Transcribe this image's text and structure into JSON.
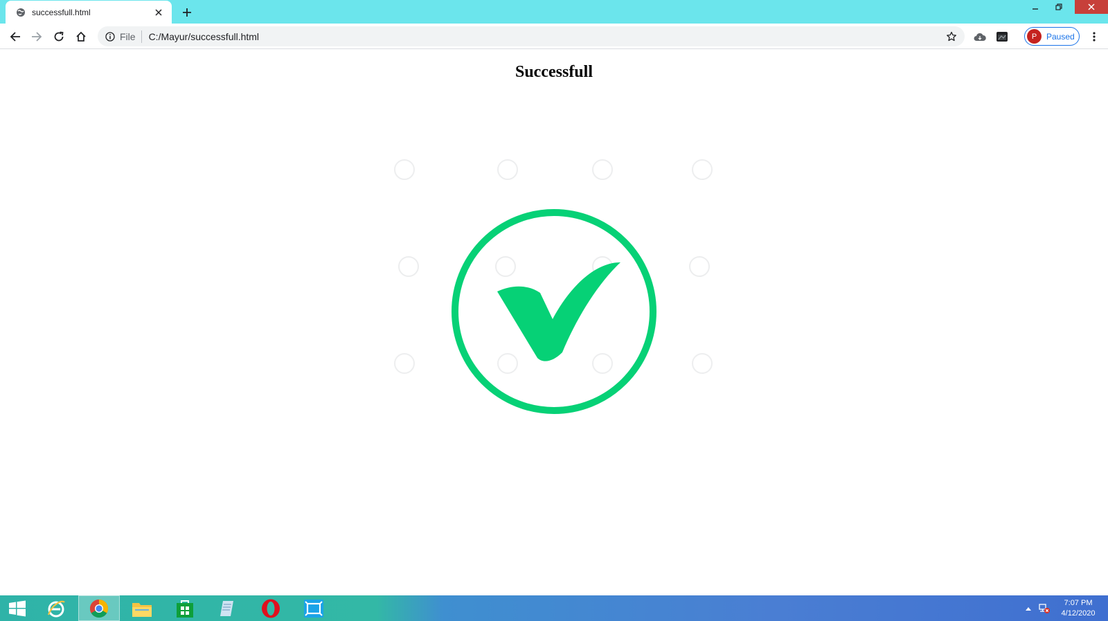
{
  "browser": {
    "tab": {
      "title": "successfull.html",
      "favicon": "globe-icon"
    },
    "address_bar": {
      "scheme_label": "File",
      "url": "C:/Mayur/successfull.html"
    },
    "profile": {
      "initial": "P",
      "status": "Paused"
    }
  },
  "page": {
    "heading": "Successfull",
    "image": {
      "icon": "checkmark-circle-icon",
      "color": "#06d176"
    }
  },
  "taskbar": {
    "apps": [
      "windows-start",
      "internet-explorer",
      "chrome",
      "file-explorer",
      "store",
      "notepad",
      "opera",
      "camera-app"
    ],
    "active_app": "chrome",
    "clock": {
      "time": "7:07 PM",
      "date": "4/12/2020"
    }
  },
  "colors": {
    "tab_strip": "#6be5ec",
    "accent": "#1a73e8",
    "success_green": "#06d176"
  }
}
